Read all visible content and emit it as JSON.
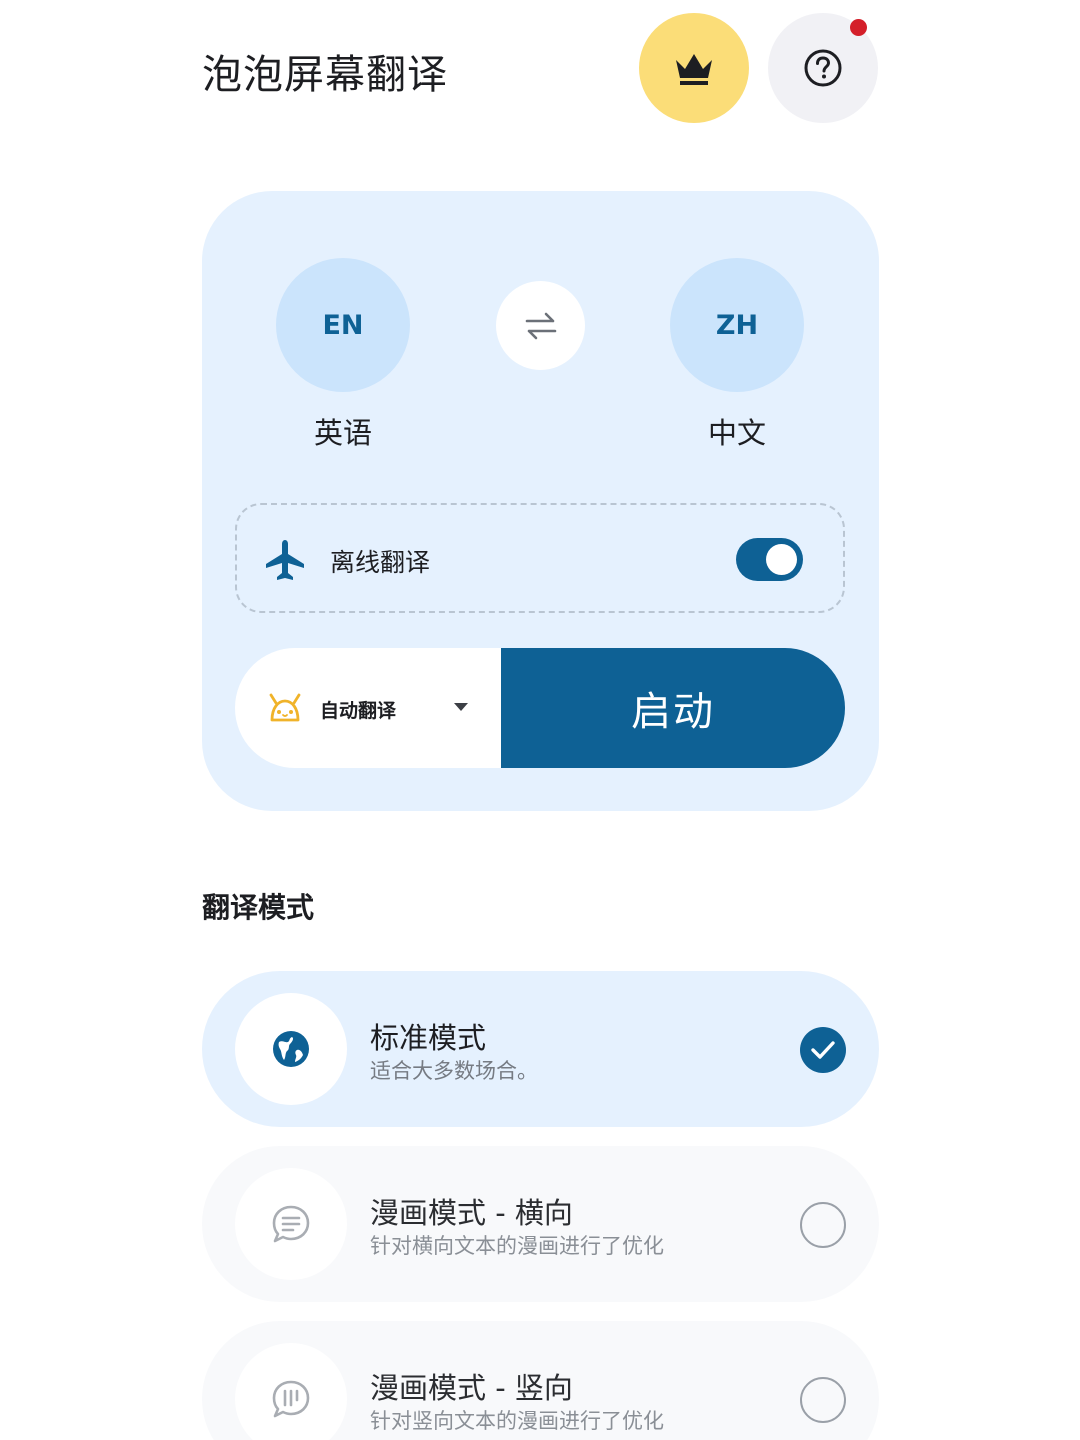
{
  "header": {
    "title": "泡泡屏幕翻译",
    "premium_icon": "crown-icon",
    "help_icon": "help-circle-icon",
    "help_has_notification": true
  },
  "languages": {
    "source": {
      "code": "EN",
      "name": "英语"
    },
    "target": {
      "code": "ZH",
      "name": "中文"
    },
    "swap_icon": "swap-arrows-icon"
  },
  "offline": {
    "label": "离线翻译",
    "icon": "airplane-icon",
    "enabled": true
  },
  "auto_mode": {
    "label": "自动翻译",
    "icon": "android-robot-icon"
  },
  "start_button": {
    "label": "启动"
  },
  "modes_section": {
    "title": "翻译模式",
    "items": [
      {
        "title": "标准模式",
        "desc": "适合大多数场合。",
        "icon": "globe-icon",
        "selected": true
      },
      {
        "title": "漫画模式 - 横向",
        "desc": "针对横向文本的漫画进行了优化",
        "icon": "speech-bubble-lines-icon",
        "selected": false
      },
      {
        "title": "漫画模式 - 竖向",
        "desc": "针对竖向文本的漫画进行了优化",
        "icon": "speech-bubble-vertical-icon",
        "selected": false
      }
    ]
  },
  "colors": {
    "accent": "#0e6195",
    "panel_bg": "#e5f1fe",
    "crown_bg": "#fbdd78",
    "notification": "#d41f2a"
  }
}
